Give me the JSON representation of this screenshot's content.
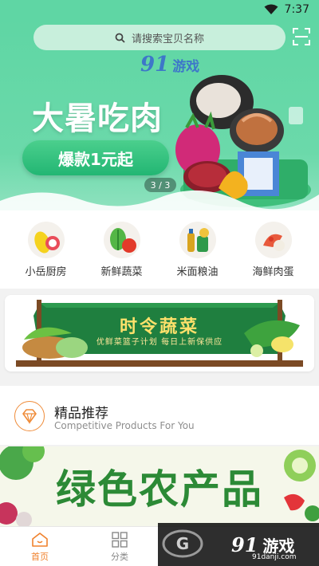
{
  "status_bar": {
    "time": "7:37"
  },
  "search": {
    "placeholder": "请搜索宝贝名称"
  },
  "banner": {
    "logo_num": "91",
    "logo_text": "游戏",
    "headline": "大暑吃肉",
    "button": "爆款1元起",
    "indicator": "3 / 3"
  },
  "categories": [
    {
      "label": "小岳厨房",
      "icon": "fruit-icon"
    },
    {
      "label": "新鲜蔬菜",
      "icon": "vegetable-icon"
    },
    {
      "label": "米面粮油",
      "icon": "grain-oil-icon"
    },
    {
      "label": "海鲜肉蛋",
      "icon": "seafood-icon"
    }
  ],
  "seasonal": {
    "title": "时令蔬菜",
    "subtitle": "优鲜菜篮子计划 每日上新保供应"
  },
  "section": {
    "title": "精品推荐",
    "subtitle": "Competitive Products For You",
    "icon": "diamond-icon"
  },
  "product_banner": {
    "title": "绿色农产品"
  },
  "nav": {
    "tabs": [
      {
        "label": "首页",
        "icon": "home-icon",
        "active": true
      },
      {
        "label": "分类",
        "icon": "grid-icon",
        "active": false
      }
    ]
  },
  "watermark": {
    "num": "91",
    "text": "游戏",
    "site": "91danji.com"
  },
  "colors": {
    "primary_green": "#5fd6a4",
    "accent_orange": "#f0822d",
    "button_green": "#22b673"
  }
}
